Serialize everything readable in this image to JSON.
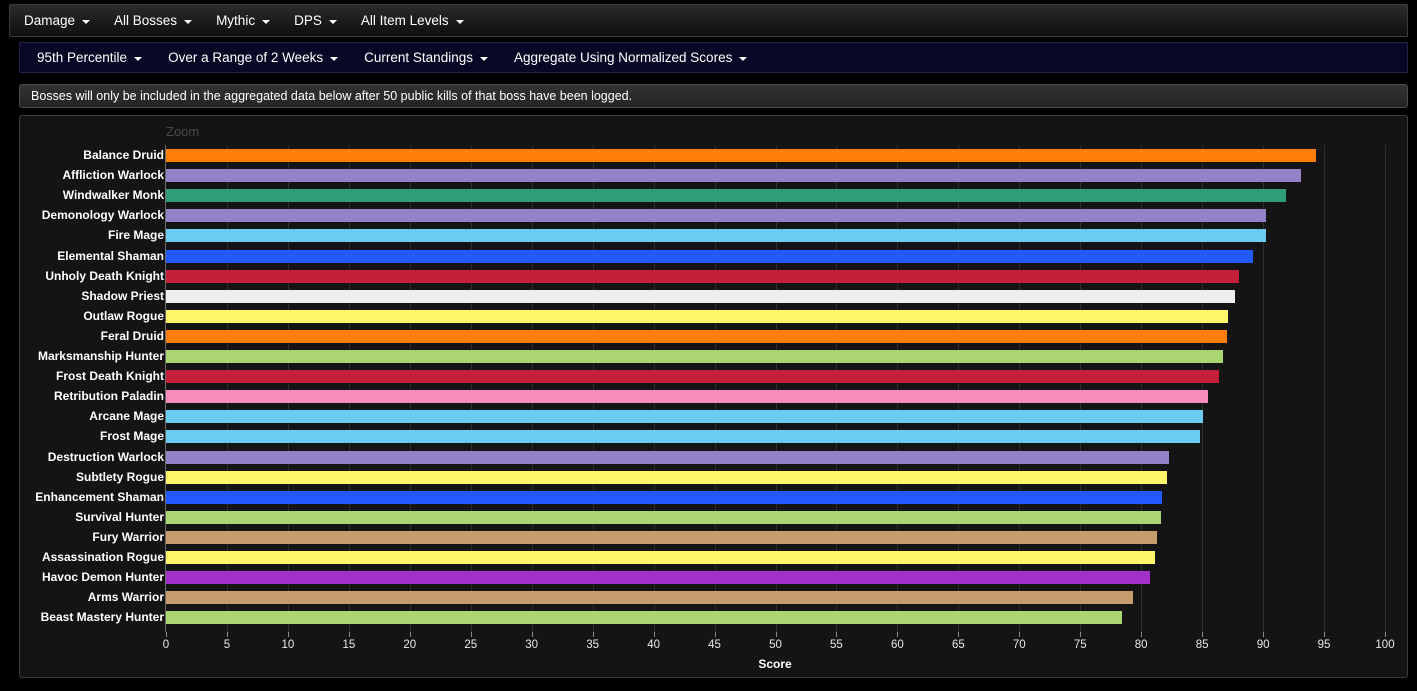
{
  "primary_nav": {
    "items": [
      {
        "label": "Damage",
        "has_caret": true,
        "name": "nav-metric-damage"
      },
      {
        "label": "All Bosses",
        "has_caret": true,
        "name": "nav-boss-filter"
      },
      {
        "label": "Mythic",
        "has_caret": true,
        "name": "nav-difficulty"
      },
      {
        "label": "DPS",
        "has_caret": true,
        "name": "nav-role"
      },
      {
        "label": "All Item Levels",
        "has_caret": true,
        "name": "nav-item-level"
      }
    ]
  },
  "secondary_nav": {
    "items": [
      {
        "label": "95th Percentile",
        "has_caret": true,
        "name": "nav-percentile"
      },
      {
        "label": "Over a Range of 2 Weeks",
        "has_caret": true,
        "name": "nav-time-range"
      },
      {
        "label": "Current Standings",
        "has_caret": true,
        "name": "nav-standings"
      },
      {
        "label": "Aggregate Using Normalized Scores",
        "has_caret": true,
        "name": "nav-aggregation"
      }
    ]
  },
  "notice": {
    "text": "Bosses will only be included in the aggregated data below after 50 public kills of that boss have been logged."
  },
  "chart_panel": {
    "zoom_label": "Zoom"
  },
  "chart_data": {
    "type": "bar",
    "orientation": "horizontal",
    "title": "",
    "xlabel": "Score",
    "ylabel": "",
    "xlim": [
      0,
      100
    ],
    "xticks": [
      0,
      5,
      10,
      15,
      20,
      25,
      30,
      35,
      40,
      45,
      50,
      55,
      60,
      65,
      70,
      75,
      80,
      85,
      90,
      95,
      100
    ],
    "grid": true,
    "legend": "none",
    "categories": [
      "Balance Druid",
      "Affliction Warlock",
      "Windwalker Monk",
      "Demonology Warlock",
      "Fire Mage",
      "Elemental Shaman",
      "Unholy Death Knight",
      "Shadow Priest",
      "Outlaw Rogue",
      "Feral Druid",
      "Marksmanship Hunter",
      "Frost Death Knight",
      "Retribution Paladin",
      "Arcane Mage",
      "Frost Mage",
      "Destruction Warlock",
      "Subtlety Rogue",
      "Enhancement Shaman",
      "Survival Hunter",
      "Fury Warrior",
      "Assassination Rogue",
      "Havoc Demon Hunter",
      "Arms Warrior",
      "Beast Mastery Hunter"
    ],
    "values": [
      94.3,
      93.1,
      91.9,
      90.2,
      90.2,
      89.2,
      88.0,
      87.7,
      87.1,
      87.0,
      86.7,
      86.4,
      85.5,
      85.1,
      84.8,
      82.3,
      82.1,
      81.7,
      81.6,
      81.3,
      81.1,
      80.7,
      79.3,
      78.4
    ],
    "colors": [
      "#ff7d0a",
      "#9482c9",
      "#2e9e76",
      "#9482c9",
      "#69ccf0",
      "#2459ff",
      "#c41f3b",
      "#eeeeee",
      "#fff569",
      "#ff7d0a",
      "#abd473",
      "#c41f3b",
      "#f58cba",
      "#69ccf0",
      "#69ccf0",
      "#9482c9",
      "#fff569",
      "#2459ff",
      "#abd473",
      "#c79c6e",
      "#fff569",
      "#a330c9",
      "#c79c6e",
      "#abd473"
    ]
  }
}
